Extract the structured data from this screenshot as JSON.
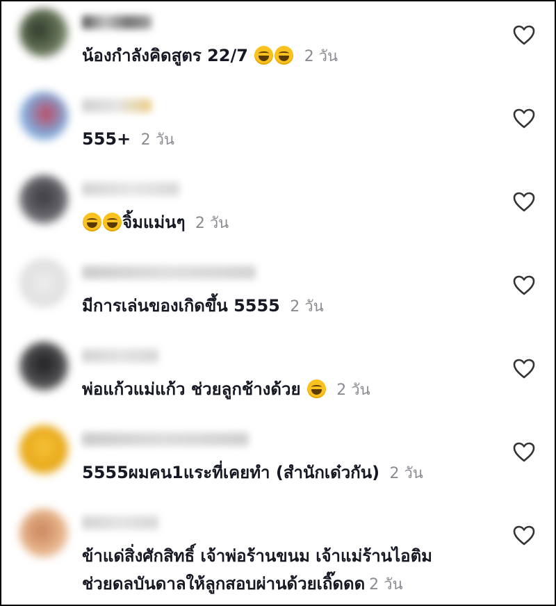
{
  "comments": [
    {
      "text": "น้องกำลังคิดสูตร 22/7",
      "emoji_after": 2,
      "time": "2 วัน"
    },
    {
      "text": "555+",
      "time": "2 วัน"
    },
    {
      "text": "จิ้มแม่นๆ",
      "emoji_before": 2,
      "time": "2 วัน"
    },
    {
      "text": "มีการเล่นของเกิดขึ้น 5555",
      "time": "2 วัน"
    },
    {
      "text": "พ่อแก้วแม่แก้ว ช่วยลูกช้างด้วย",
      "emoji_after": 1,
      "time": "2 วัน"
    },
    {
      "text": "5555ผมคน1แระที่เคยทำ (สำนักเด๋วกัน)",
      "time": "2 วัน"
    },
    {
      "text_line1": "ข้าแด่สิ่งศักสิทธิ์ เจ้าพ่อร้านขนม เจ้าแม่ร้านไอติม",
      "text_line2": "ช่วยดลบันดาลให้ลูกสอบผ่านด้วยเถิ๊ดดด",
      "time": "2 วัน"
    }
  ],
  "icons": {
    "like": "heart-outline-icon",
    "emoji": "laughing-emoji-icon"
  },
  "colors": {
    "text": "#161823",
    "time": "#8a8b91",
    "icon": "#333333"
  }
}
